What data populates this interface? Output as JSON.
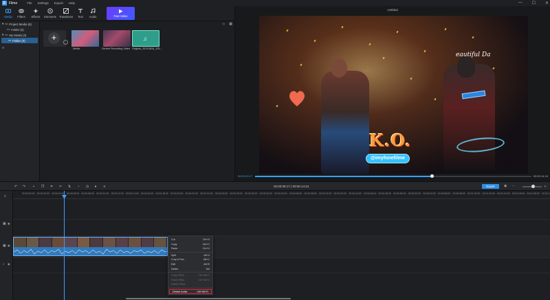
{
  "app": {
    "name": "Filme",
    "logo_glyph": "F"
  },
  "menu": [
    "File",
    "Settings",
    "Export",
    "Help"
  ],
  "window_controls": [
    "—",
    "☐",
    "✕"
  ],
  "toolbar": {
    "tools": [
      {
        "label": "Media",
        "icon": "media-icon"
      },
      {
        "label": "Filters",
        "icon": "filters-icon"
      },
      {
        "label": "Effects",
        "icon": "effects-icon"
      },
      {
        "label": "Elements",
        "icon": "elements-icon"
      },
      {
        "label": "Transitions",
        "icon": "transitions-icon"
      },
      {
        "label": "Text",
        "icon": "text-icon"
      },
      {
        "label": "Audio",
        "icon": "audio-icon"
      }
    ],
    "fast_video": "Fast Video",
    "accent": "#3aa0ff"
  },
  "sidebar": {
    "items": [
      {
        "label": "Project Media (6)",
        "level": 0
      },
      {
        "label": "Folder (6)",
        "level": 1
      },
      {
        "label": "My Media (3)",
        "level": 0
      },
      {
        "label": "Folder (3)",
        "level": 1,
        "selected": true
      }
    ]
  },
  "media": {
    "items": [
      {
        "label": "Media",
        "color": "#3b6c9a"
      },
      {
        "label": "Screen Recording Video",
        "color": "#5a4a6a"
      },
      {
        "label": "Original_20210818_125...",
        "color": "#2e9e8a"
      }
    ]
  },
  "preview": {
    "title": "Untitled",
    "overlay_ko": "K.O.",
    "overlay_handle": "@imyfonefilme",
    "overlay_text": "eautiful Da",
    "current_time": "00:00:09.17",
    "total_time": "00:00:14.24",
    "progress": 0.64
  },
  "timeline": {
    "timecode": "00:00:09:17 | 00:00:14:24",
    "export_label": "Export",
    "ruler": [
      "00:00:00:00",
      "00:00:02:00",
      "00:00:04:00",
      "00:00:06:00",
      "00:00:08:00",
      "00:00:10:00",
      "00:00:12:00",
      "00:00:14:00",
      "00:00:16:00",
      "00:00:18:00",
      "00:00:20:00",
      "00:00:22:00",
      "00:00:24:00",
      "00:00:26:00",
      "00:00:28:00",
      "00:00:30:00",
      "00:00:32:00",
      "00:00:34:00",
      "00:00:36:00",
      "00:00:38:00",
      "00:00:40:00",
      "00:00:42:00",
      "00:00:44:00",
      "00:00:46:00",
      "00:00:48:00",
      "00:00:50:00",
      "00:00:52:00",
      "00:00:54:00",
      "00:00:56:00",
      "00:00:58:00",
      "00:01:00:00",
      "00:01:02:00",
      "00:01:04:00",
      "00:01:06:00",
      "00:01:08:00",
      "00:01:10:00"
    ]
  },
  "context_menu": {
    "groups": [
      [
        {
          "label": "Cut",
          "shortcut": "Ctrl+X"
        },
        {
          "label": "Copy",
          "shortcut": "Ctrl+C"
        },
        {
          "label": "Paste",
          "shortcut": "Ctrl+V"
        }
      ],
      [
        {
          "label": "Split",
          "shortcut": "Alt+X"
        },
        {
          "label": "Crop & Pan",
          "shortcut": "Alt+C"
        },
        {
          "label": "Edit",
          "shortcut": "Alt+E"
        },
        {
          "label": "Delete",
          "shortcut": "Del"
        }
      ],
      [
        {
          "label": "Copy Effect",
          "shortcut": "Ctrl+Alt+C",
          "disabled": true
        },
        {
          "label": "Paste Effect",
          "shortcut": "Ctrl+Alt+V",
          "disabled": true
        },
        {
          "label": "Delete Effect",
          "shortcut": "",
          "disabled": true
        }
      ],
      [
        {
          "label": "Detach Audio",
          "shortcut": "Ctrl+Alt+D",
          "highlighted": true
        }
      ]
    ],
    "highlight_color": "#e2232f"
  }
}
